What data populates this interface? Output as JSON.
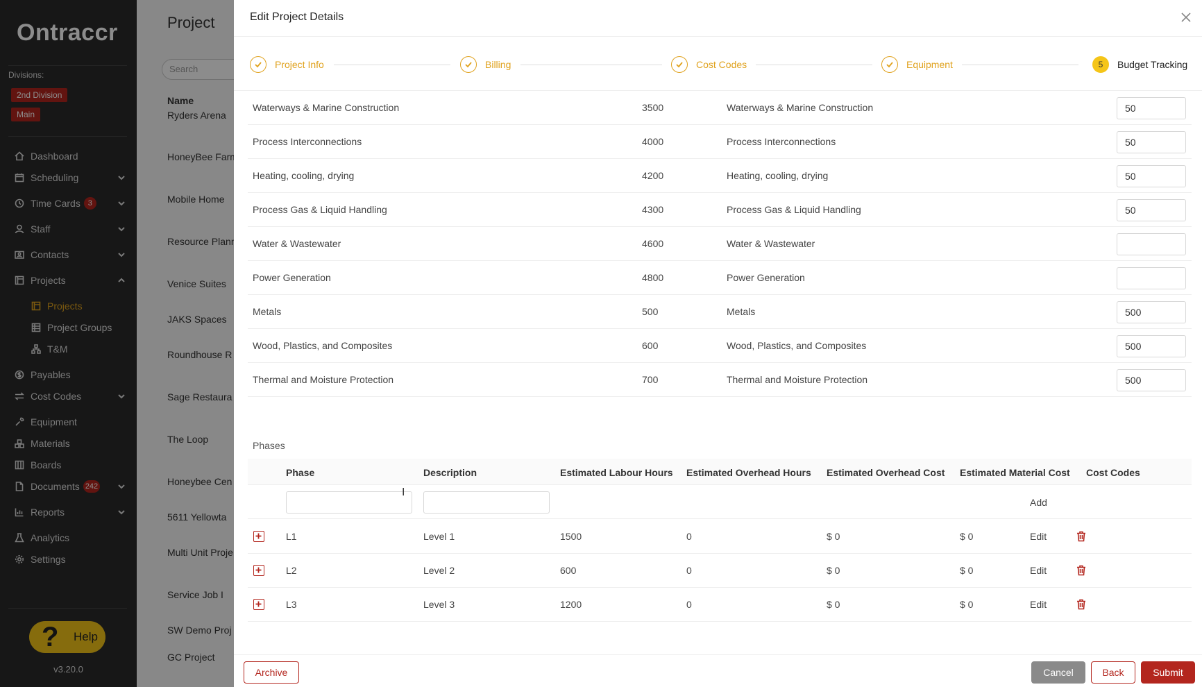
{
  "app": {
    "logo_text": "Ontraccr",
    "version": "v3.20.0",
    "help_label": "Help"
  },
  "divisions": {
    "label": "Divisions:",
    "items": [
      "2nd Division",
      "Main"
    ]
  },
  "nav": [
    {
      "label": "Dashboard",
      "icon": "home-icon"
    },
    {
      "label": "Scheduling",
      "icon": "calendar-icon"
    },
    {
      "label": "Time Cards",
      "icon": "clock-icon",
      "badge": "3"
    },
    {
      "label": "Staff",
      "icon": "person-icon"
    },
    {
      "label": "Contacts",
      "icon": "contact-card-icon"
    },
    {
      "label": "Projects",
      "icon": "project-icon"
    },
    {
      "label": "Projects",
      "icon": "project-icon"
    },
    {
      "label": "Project Groups",
      "icon": "grid-icon"
    },
    {
      "label": "T&M",
      "icon": "hierarchy-icon"
    },
    {
      "label": "Payables",
      "icon": "dollar-icon"
    },
    {
      "label": "Cost Codes",
      "icon": "swap-icon"
    },
    {
      "label": "Equipment",
      "icon": "wrench-icon"
    },
    {
      "label": "Materials",
      "icon": "boxes-icon"
    },
    {
      "label": "Boards",
      "icon": "board-icon"
    },
    {
      "label": "Documents",
      "icon": "document-icon",
      "badge": "242"
    },
    {
      "label": "Reports",
      "icon": "chart-icon"
    },
    {
      "label": "Analytics",
      "icon": "flask-icon"
    },
    {
      "label": "Settings",
      "icon": "gear-icon"
    }
  ],
  "background_page": {
    "title": "Project",
    "search_placeholder": "Search",
    "column_name": "Name",
    "rows": [
      "Ryders Arena",
      "HoneyBee Farm",
      "Mobile Home",
      "Resource Plann",
      "Venice Suites",
      "JAKS Spaces",
      "Roundhouse R",
      "Sage Restaura",
      "The Loop",
      "Honeybee Cen",
      "5611 Yellowta",
      "Multi Unit Proje",
      "Service Job I",
      "SW Demo Proj",
      "GC Project"
    ]
  },
  "modal": {
    "title": "Edit Project Details",
    "steps": [
      {
        "label": "Project Info",
        "done": true
      },
      {
        "label": "Billing",
        "done": true
      },
      {
        "label": "Cost Codes",
        "done": true
      },
      {
        "label": "Equipment",
        "done": true
      },
      {
        "label": "Budget Tracking",
        "number": "5",
        "current": true
      }
    ],
    "cost_code_rows": [
      {
        "name": "Waterways & Marine Construction",
        "code": "3500",
        "phase": "Waterways & Marine Construction",
        "value": "50"
      },
      {
        "name": "Process Interconnections",
        "code": "4000",
        "phase": "Process Interconnections",
        "value": "50"
      },
      {
        "name": "Heating, cooling, drying",
        "code": "4200",
        "phase": "Heating, cooling, drying",
        "value": "50"
      },
      {
        "name": "Process Gas & Liquid Handling",
        "code": "4300",
        "phase": "Process Gas & Liquid Handling",
        "value": "50"
      },
      {
        "name": "Water & Wastewater",
        "code": "4600",
        "phase": "Water & Wastewater",
        "value": ""
      },
      {
        "name": "Power Generation",
        "code": "4800",
        "phase": "Power Generation",
        "value": ""
      },
      {
        "name": "Metals",
        "code": "500",
        "phase": "Metals",
        "value": "500"
      },
      {
        "name": "Wood, Plastics, and Composites",
        "code": "600",
        "phase": "Wood, Plastics, and Composites",
        "value": "500"
      },
      {
        "name": "Thermal and Moisture Protection",
        "code": "700",
        "phase": "Thermal and Moisture Protection",
        "value": "500"
      }
    ],
    "phases_label": "Phases",
    "phase_columns": [
      "Phase",
      "Description",
      "Estimated Labour Hours",
      "Estimated Overhead Hours",
      "Estimated Overhead Cost",
      "Estimated Material Cost",
      "Cost Codes"
    ],
    "add_label": "Add",
    "phase_rows": [
      {
        "phase": "L1",
        "description": "Level 1",
        "labour": "1500",
        "overhead_hours": "0",
        "overhead_cost": "$ 0",
        "material_cost": "$ 0",
        "edit": "Edit"
      },
      {
        "phase": "L2",
        "description": "Level 2",
        "labour": "600",
        "overhead_hours": "0",
        "overhead_cost": "$ 0",
        "material_cost": "$ 0",
        "edit": "Edit"
      },
      {
        "phase": "L3",
        "description": "Level 3",
        "labour": "1200",
        "overhead_hours": "0",
        "overhead_cost": "$ 0",
        "material_cost": "$ 0",
        "edit": "Edit"
      }
    ],
    "buttons": {
      "archive": "Archive",
      "cancel": "Cancel",
      "back": "Back",
      "submit": "Submit"
    }
  },
  "colors": {
    "accent": "#e0a21d",
    "brand_red": "#b3261e",
    "sidebar_bg": "#2a2a2a",
    "help_yellow": "#f5c518"
  }
}
